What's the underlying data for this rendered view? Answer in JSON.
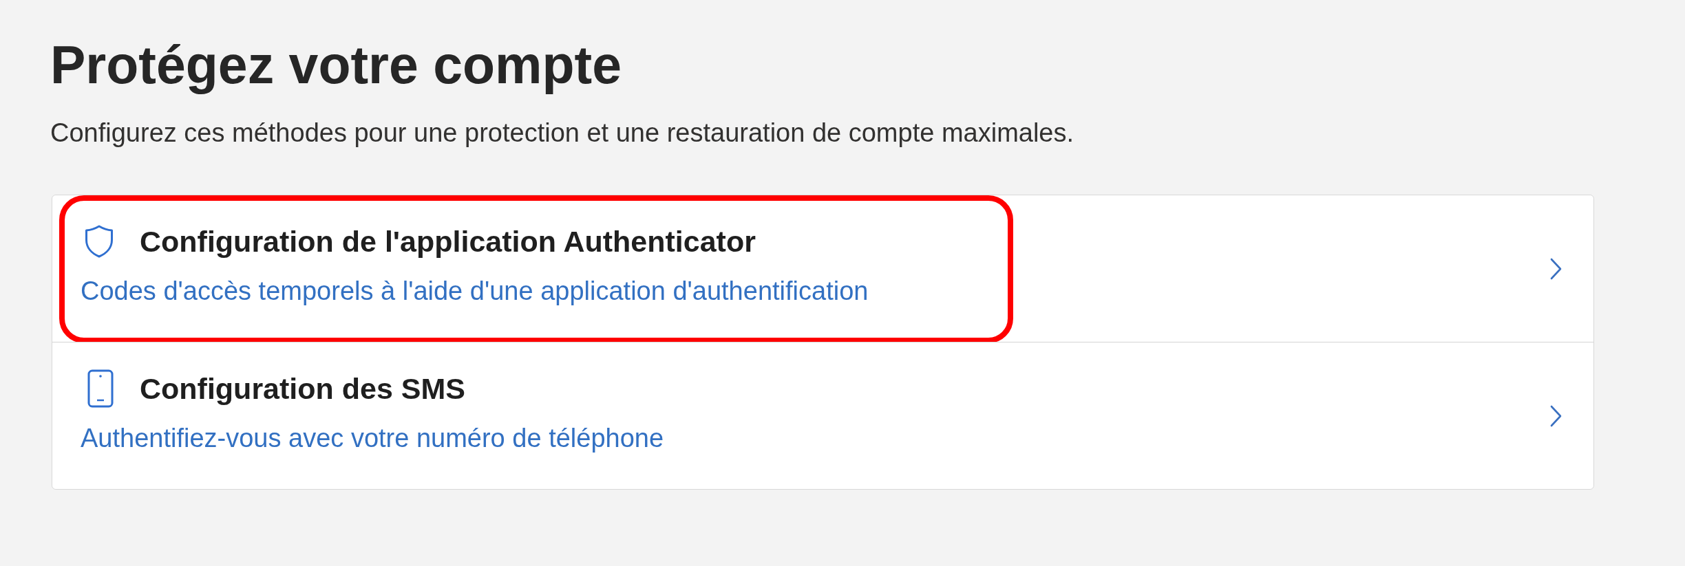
{
  "page": {
    "title": "Protégez votre compte",
    "subtitle": "Configurez ces méthodes pour une protection et une restauration de compte maximales."
  },
  "methods": [
    {
      "kind": "authenticator",
      "title": "Configuration de l'application Authenticator",
      "description": "Codes d'accès temporels à l'aide d'une application d'authentification",
      "highlighted": true
    },
    {
      "kind": "sms",
      "title": "Configuration des SMS",
      "description": "Authentifiez-vous avec votre numéro de téléphone",
      "highlighted": false
    }
  ]
}
